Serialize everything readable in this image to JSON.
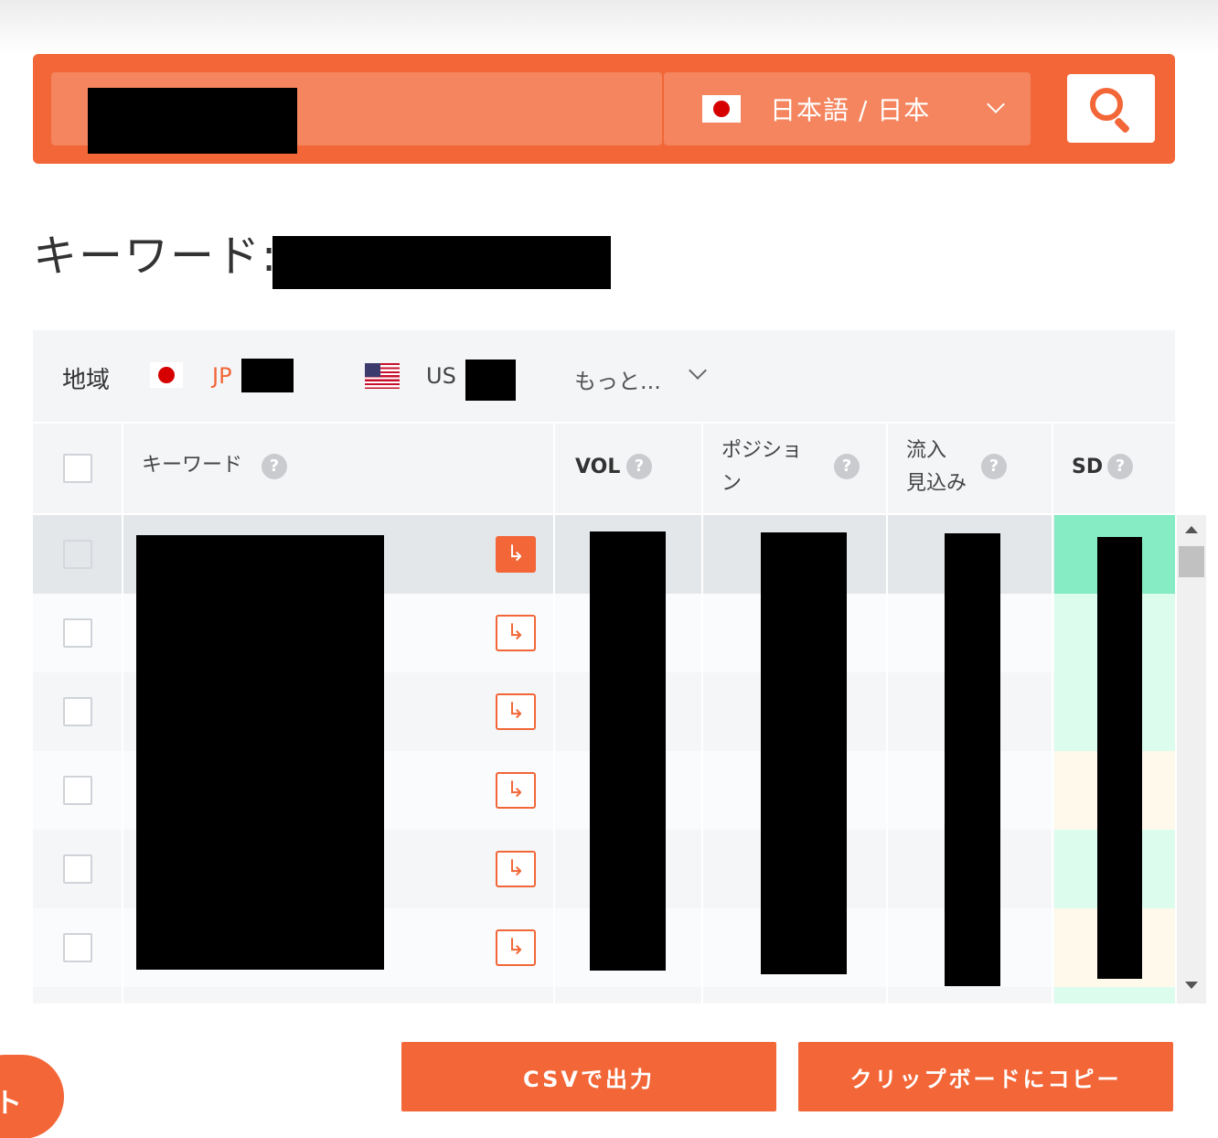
{
  "search": {
    "query_value": "",
    "language_label": "日本語 / 日本"
  },
  "heading": {
    "label": "キーワード:"
  },
  "region": {
    "label": "地域",
    "jp": "JP",
    "us": "US",
    "more": "もっと..."
  },
  "table": {
    "headers": {
      "keyword": "キーワード",
      "vol": "VOL",
      "position_line1": "ポジショ",
      "position_line2": "ン",
      "traffic_line1": "流入",
      "traffic_line2": "見込み",
      "sd": "SD"
    },
    "help_glyph": "?",
    "go_glyph": "↳",
    "row_count": 6,
    "sd_colors": [
      "#86ecc3",
      "#dcfcee",
      "#dcfcee",
      "#fff9ec",
      "#dcfcee",
      "#fff9ec"
    ]
  },
  "actions": {
    "csv": "CSVで出力",
    "clipboard": "クリップボードにコピー",
    "floating": "ト"
  },
  "colors": {
    "accent": "#f26637",
    "accent_light": "#f4855e"
  },
  "icons": {
    "search": "search-icon",
    "chevron": "chevron-down-icon",
    "help": "help-icon",
    "go": "open-arrow-icon"
  }
}
